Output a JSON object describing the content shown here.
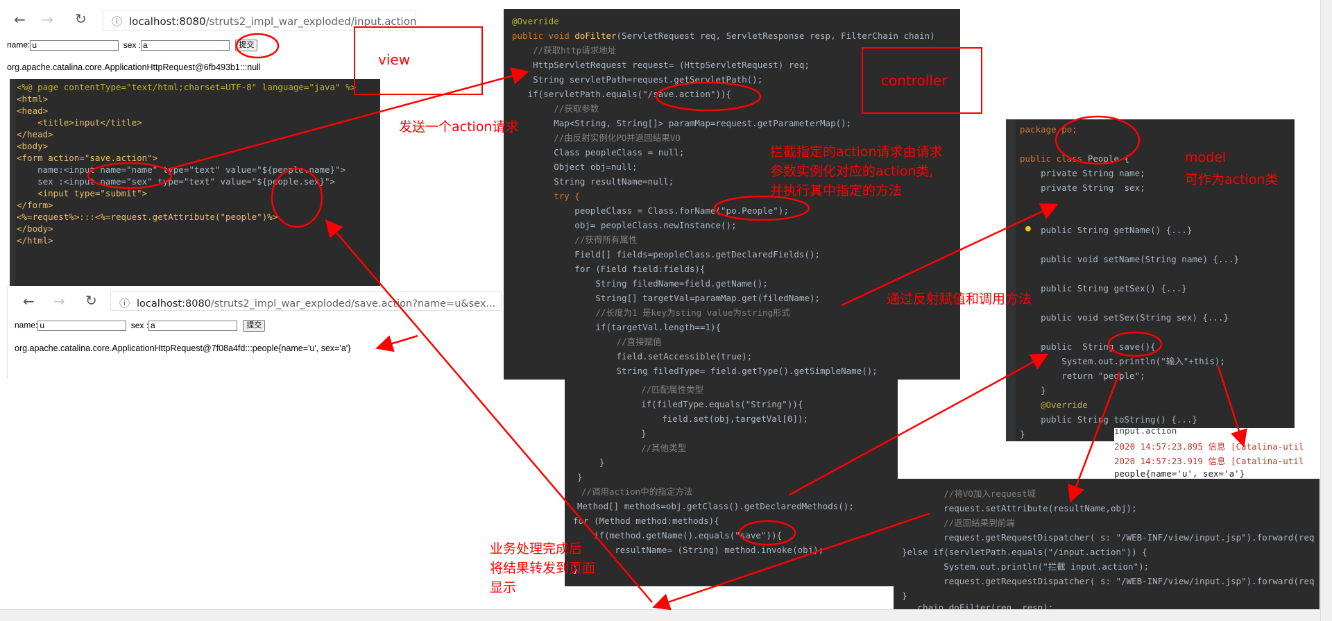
{
  "browser_top": {
    "url_host": "localhost:8080",
    "url_path": "/struts2_impl_war_exploded/input.action",
    "name_label": "name:",
    "name_value": "u",
    "sex_label": "sex :",
    "sex_value": "a",
    "submit_label": "提交",
    "output": "org.apache.catalina.core.ApplicationHttpRequest@6fb493b1:::null"
  },
  "browser_bottom": {
    "url_host": "localhost:8080",
    "url_path": "/struts2_impl_war_exploded/save.action?name=u&sex...",
    "name_label": "name:",
    "name_value": "u",
    "sex_label": "sex :",
    "sex_value": "a",
    "submit_label": "提交",
    "output": "org.apache.catalina.core.ApplicationHttpRequest@7f08a4fd:::people{name='u', sex='a'}"
  },
  "jsp_code": [
    "<%@ page contentType=\"text/html;charset=UTF-8\" language=\"java\" %>",
    "<html>",
    "<head>",
    "    <title>input</title>",
    "</head>",
    "<body>",
    "<form action=\"save.action\">",
    "    name:<input name=\"name\" type=\"text\" value=\"${people.name}\">",
    "    sex :<input name=\"sex\" type=\"text\" value=\"${people.sex}\">",
    "    <input type=\"submit\">",
    "</form>",
    "<%=request%>:::<%=request.getAttribute(\"people\")%>",
    "</body>",
    "</html>"
  ],
  "filter_code_top": [
    "@Override",
    "public void doFilter(ServletRequest req, ServletResponse resp, FilterChain chain)",
    "    //获取http请求地址",
    "    HttpServletRequest request= (HttpServletRequest) req;",
    "    String servletPath=request.getServletPath();",
    "   if(servletPath.equals(\"/save.action\")){",
    "        //获取参数",
    "        Map<String, String[]> paramMap=request.getParameterMap();",
    "        //由反射实例化PO并返回结果VO",
    "        Class peopleClass = null;",
    "        Object obj=null;",
    "        String resultName=null;",
    "        try {",
    "            peopleClass = Class.forName(\"po.People\");",
    "            obj= peopleClass.newInstance();",
    "            //获得所有属性",
    "            Field[] fields=peopleClass.getDeclaredFields();",
    "            for (Field field:fields){",
    "                String filedName=field.getName();",
    "                String[] targetVal=paramMap.get(filedName);",
    "                //长度为1 是key为sting value为string形式",
    "                if(targetVal.length==1){",
    "                    //直接赋值",
    "                    field.setAccessible(true);",
    "                    String filedType= field.getType().getSimpleName();"
  ],
  "filter_code_mid": [
    "    //匹配属性类型",
    "    if(filedType.equals(\"String\")){",
    "        field.set(obj,targetVal[0]);",
    "    }",
    "    //其他类型",
    "}",
    "}",
    "//调用action中的指定方法",
    "Method[] methods=obj.getClass().getDeclaredMethods();",
    "for (Method method:methods){",
    "    if(method.getName().equals(\"save\")){",
    "        resultName= (String) method.invoke(obj);",
    "}"
  ],
  "people_code": [
    "package po;",
    "",
    "public class People {",
    "    private String name;",
    "    private String  sex;",
    "",
    "",
    "    public String getName() {...}",
    "",
    "    public void setName(String name) {...}",
    "",
    "    public String getSex() {...}",
    "",
    "    public void setSex(String sex) {...}",
    "",
    "    public  String save(){",
    "        System.out.println(\"输入\"+this);",
    "        return \"people\";",
    "    }",
    "    @Override",
    "    public String toString() {...}",
    "}"
  ],
  "console_lines": [
    "input.action",
    "2020 14:57:23.895 信息 [Catalina-util",
    "2020 14:57:23.919 信息 [Catalina-util",
    "people{name='u', sex='a'}"
  ],
  "dispatch_code": [
    "        //将VO加入request域",
    "        request.setAttribute(resultName,obj);",
    "        //返回结果到前端",
    "        request.getRequestDispatcher( s: \"/WEB-INF/view/input.jsp\").forward(req",
    "}else if(servletPath.equals(\"/input.action\")) {",
    "        System.out.println(\"拦截 input.action\");",
    "        request.getRequestDispatcher( s: \"/WEB-INF/view/input.jsp\").forward(req",
    "}",
    "   chain.doFilter(req, resp);"
  ],
  "annotations": {
    "view": "view",
    "controller": "controller",
    "send_action": "发送一个action请求",
    "intercept": [
      "拦截指定的action请求由请求",
      "参数实例化对应的action类,",
      "并执行其中指定的方法"
    ],
    "model": [
      "model",
      "可作为action类"
    ],
    "reflect": "通过反射赋值和调用方法",
    "forward": [
      "业务处理完成后",
      "将结果转发到页面",
      "显示"
    ]
  },
  "colors": {
    "annotation_red": "#ff0000",
    "ide_background": "#2b2b2b",
    "keyword": "#cc7832",
    "string": "#6a8759",
    "comment": "#808080"
  },
  "icons": [
    "back-arrow-icon",
    "forward-arrow-icon",
    "reload-icon",
    "info-icon",
    "bulb-icon"
  ]
}
